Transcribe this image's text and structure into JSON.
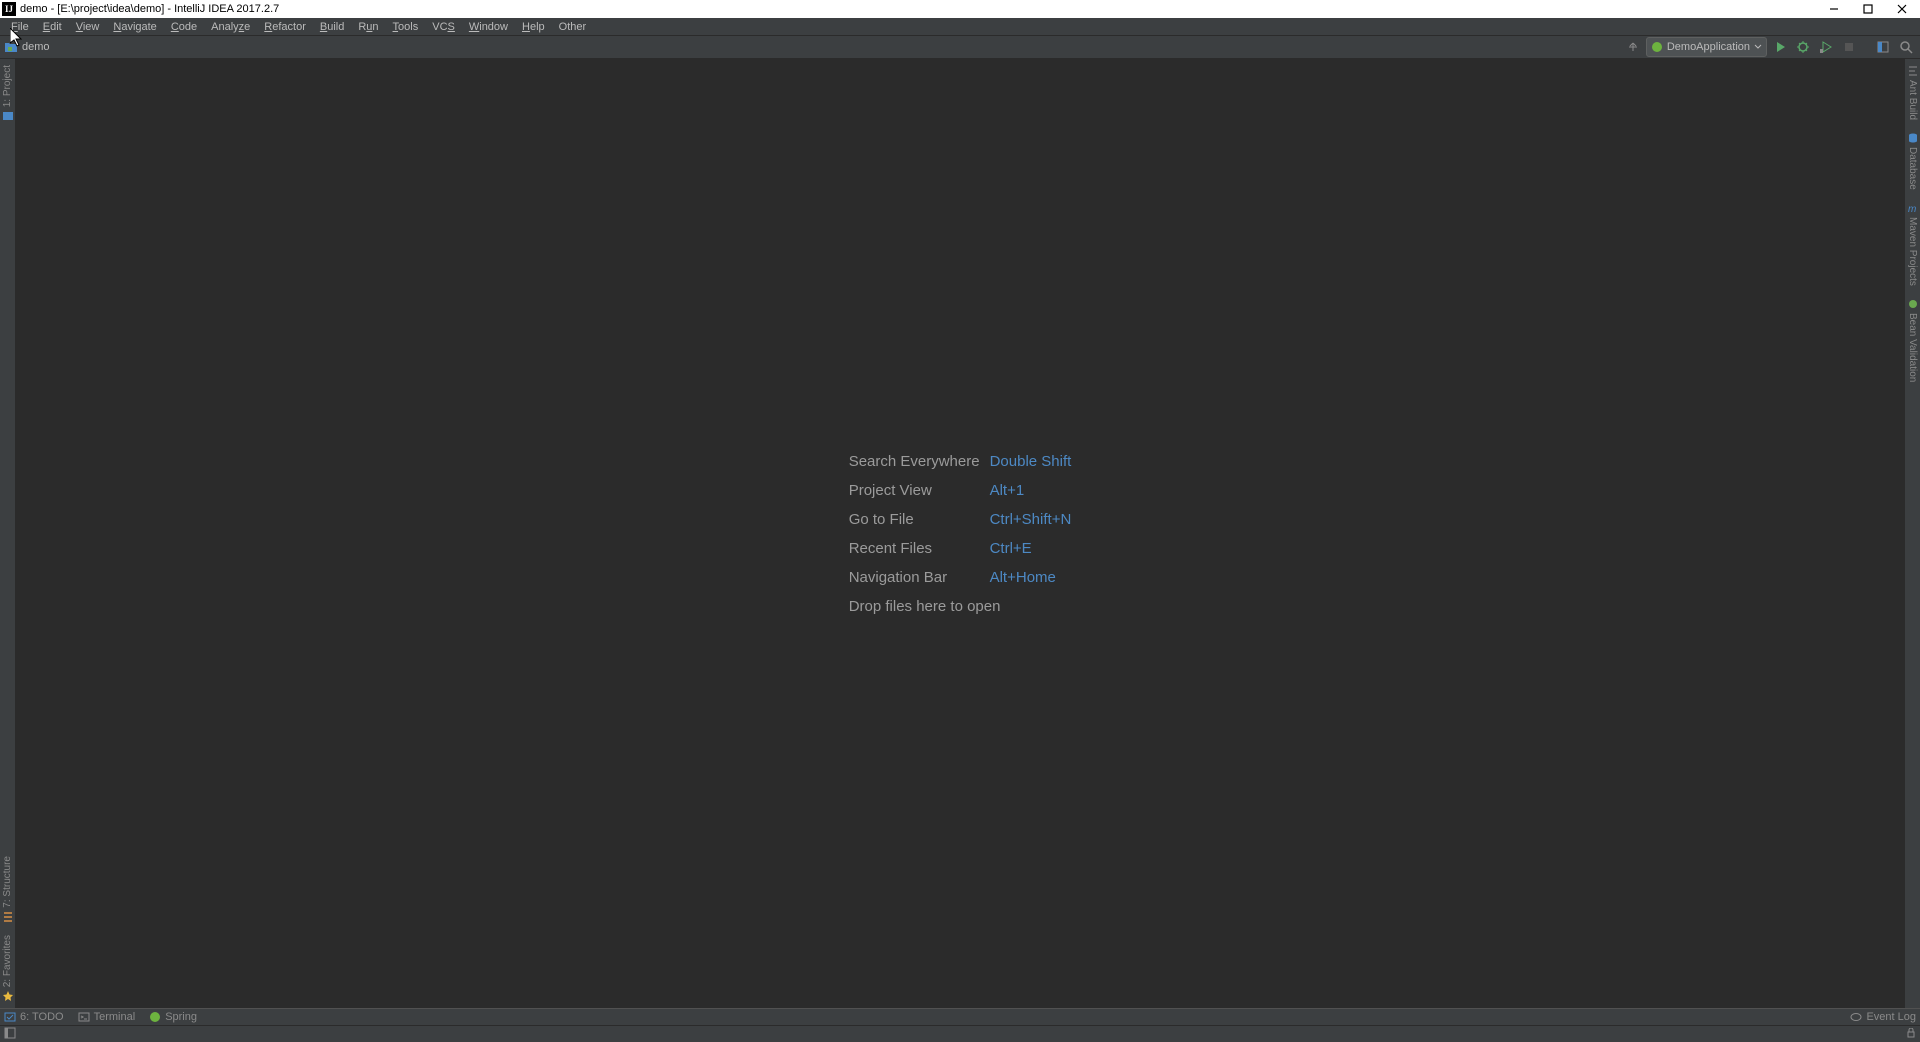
{
  "titlebar": {
    "text": "demo - [E:\\project\\idea\\demo] - IntelliJ IDEA 2017.2.7"
  },
  "menu": {
    "items": [
      "File",
      "Edit",
      "View",
      "Navigate",
      "Code",
      "Analyze",
      "Refactor",
      "Build",
      "Run",
      "Tools",
      "VCS",
      "Window",
      "Help",
      "Other"
    ]
  },
  "breadcrumb": {
    "project": "demo"
  },
  "run_config": {
    "name": "DemoApplication"
  },
  "left_gutter": {
    "top": [
      {
        "label": "1: Project",
        "icon": "project-icon",
        "color": "#4a88c7"
      }
    ],
    "bottom": [
      {
        "label": "7: Structure",
        "icon": "structure-icon",
        "color": "#d68f46"
      },
      {
        "label": "2: Favorites",
        "icon": "favorites-icon",
        "color": "#e8b93f"
      }
    ]
  },
  "right_gutter": {
    "items": [
      {
        "label": "Ant Build",
        "icon": "ant-icon",
        "color": "#8a8a8a"
      },
      {
        "label": "Database",
        "icon": "database-icon",
        "color": "#4a88c7"
      },
      {
        "label": "Maven Projects",
        "icon": "maven-icon",
        "color": "#4a88c7"
      },
      {
        "label": "Bean Validation",
        "icon": "bean-icon",
        "color": "#6aa84f"
      }
    ]
  },
  "hints": {
    "rows": [
      {
        "label": "Search Everywhere",
        "key": "Double Shift"
      },
      {
        "label": "Project View",
        "key": "Alt+1"
      },
      {
        "label": "Go to File",
        "key": "Ctrl+Shift+N"
      },
      {
        "label": "Recent Files",
        "key": "Ctrl+E"
      },
      {
        "label": "Navigation Bar",
        "key": "Alt+Home"
      }
    ],
    "drop": "Drop files here to open"
  },
  "toolwindows": {
    "left": [
      {
        "label": "6: TODO",
        "icon": "todo-icon"
      },
      {
        "label": "Terminal",
        "icon": "terminal-icon"
      },
      {
        "label": "Spring",
        "icon": "spring-icon"
      }
    ],
    "right": {
      "label": "Event Log",
      "icon": "eventlog-icon"
    }
  },
  "colors": {
    "run_green": "#59a869",
    "debug_green": "#59a869",
    "stop_red": "#c75450",
    "spring_green": "#6db33f",
    "link_blue": "#4d89c4"
  }
}
